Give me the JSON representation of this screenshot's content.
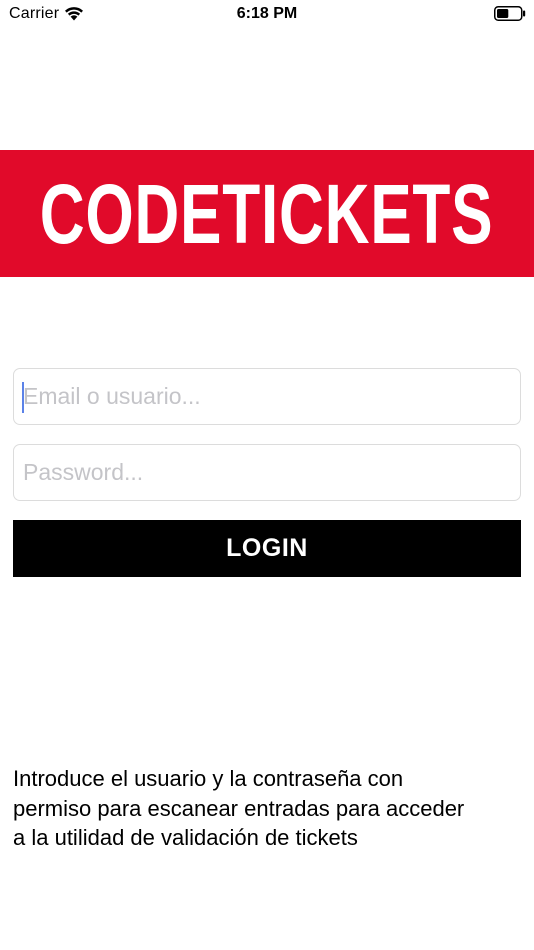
{
  "status_bar": {
    "carrier": "Carrier",
    "time": "6:18 PM",
    "wifi_icon": "wifi-icon",
    "battery_icon": "battery-icon",
    "battery_level": 0.5
  },
  "banner": {
    "title": "CODETICKETS",
    "background_color": "#e10a2a",
    "text_color": "#ffffff"
  },
  "login_form": {
    "email_placeholder": "Email o usuario...",
    "email_value": "",
    "password_placeholder": "Password...",
    "password_value": "",
    "login_label": "LOGIN"
  },
  "help": {
    "lines": [
      "Introduce el usuario y la contraseña con",
      "permiso para escanear entradas para acceder",
      "a la utilidad de validación de tickets"
    ]
  }
}
